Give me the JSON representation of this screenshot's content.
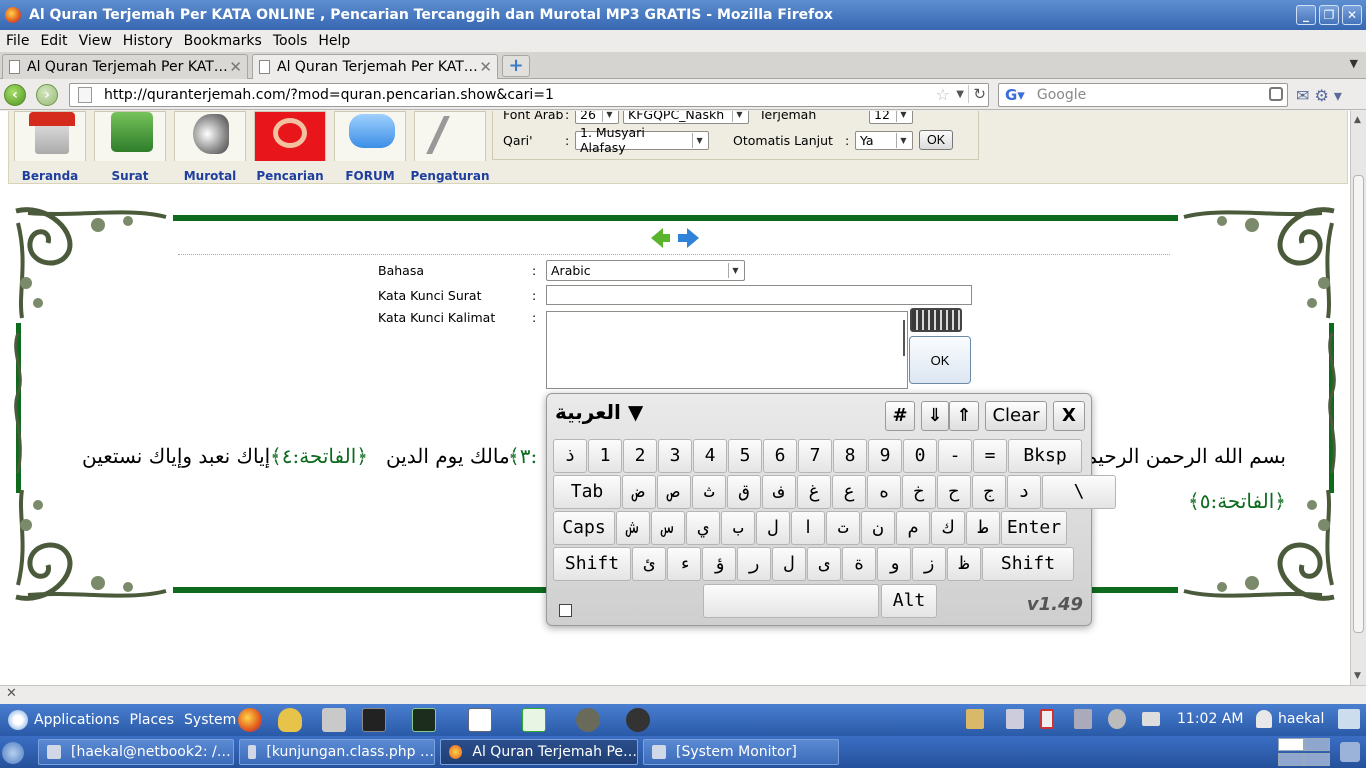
{
  "window": {
    "title": "Al Quran Terjemah Per KATA ONLINE , Pencarian Tercanggih dan Murotal MP3 GRATIS - Mozilla Firefox"
  },
  "menubar": [
    "File",
    "Edit",
    "View",
    "History",
    "Bookmarks",
    "Tools",
    "Help"
  ],
  "tabs": [
    {
      "label": "Al Quran Terjemah Per KAT…",
      "active": false
    },
    {
      "label": "Al Quran Terjemah Per KAT…",
      "active": true
    }
  ],
  "nav": {
    "url": "http://quranterjemah.com/?mod=quran.pencarian.show&cari=1",
    "search_placeholder": "Google"
  },
  "site_menu": [
    "Beranda",
    "Surat",
    "Murotal",
    "Pencarian",
    "FORUM",
    "Pengaturan"
  ],
  "settings": {
    "font_arab_label": "Font Arab",
    "font_size": "26",
    "font_name": "KFGQPC_Naskh",
    "terjemah_label": "Terjemah",
    "terjemah_value": "12",
    "qari_label": "Qari'",
    "qari_value": "1. Musyari Alafasy",
    "otomatis_label": "Otomatis Lanjut",
    "otomatis_value": "Ya",
    "ok": "OK",
    "colon": ":"
  },
  "search_form": {
    "bahasa_label": "Bahasa",
    "bahasa_value": "Arabic",
    "surat_label": "Kata Kunci Surat",
    "kalimat_label": "Kata Kunci Kalimat",
    "ok": "OK",
    "colon": ":"
  },
  "verses": {
    "line1_right": "بسم الله الرحمن الرحيم ﴿",
    "line1_mid": "﴾٣:",
    "line1_mid2": "مالك يوم الدين",
    "line1_mark": "﴿الفاتحة:٤﴾",
    "line1_left": "إياك نعبد وإياك نستعين",
    "line2_mark": "﴿الفاتحة:٥﴾"
  },
  "keyboard": {
    "title": "العربية ▼",
    "hash": "#",
    "down": "⇓",
    "up": "⇑",
    "clear": "Clear",
    "close": "X",
    "rows": [
      [
        "ذ",
        "1",
        "2",
        "3",
        "4",
        "5",
        "6",
        "7",
        "8",
        "9",
        "0",
        "-",
        "=",
        "Bksp"
      ],
      [
        "Tab",
        "ض",
        "ص",
        "ث",
        "ق",
        "ف",
        "غ",
        "ع",
        "ه",
        "خ",
        "ح",
        "ج",
        "د",
        "\\"
      ],
      [
        "Caps",
        "ش",
        "س",
        "ي",
        "ب",
        "ل",
        "ا",
        "ت",
        "ن",
        "م",
        "ك",
        "ط",
        "Enter"
      ],
      [
        "Shift",
        "ئ",
        "ء",
        "ؤ",
        "ر",
        "ل",
        "ى",
        "ة",
        "و",
        "ز",
        "ظ",
        "Shift"
      ]
    ],
    "alt": "Alt",
    "version": "v1.49"
  },
  "panel": {
    "applications": "Applications",
    "places": "Places",
    "system": "System",
    "clock": "11:02 AM",
    "user": "haekal"
  },
  "taskbar": [
    {
      "label": "[haekal@netbook2: /…",
      "active": false
    },
    {
      "label": "[kunjungan.class.php …",
      "active": false
    },
    {
      "label": "Al Quran Terjemah Pe…",
      "active": true
    },
    {
      "label": "[System Monitor]",
      "active": false
    }
  ]
}
